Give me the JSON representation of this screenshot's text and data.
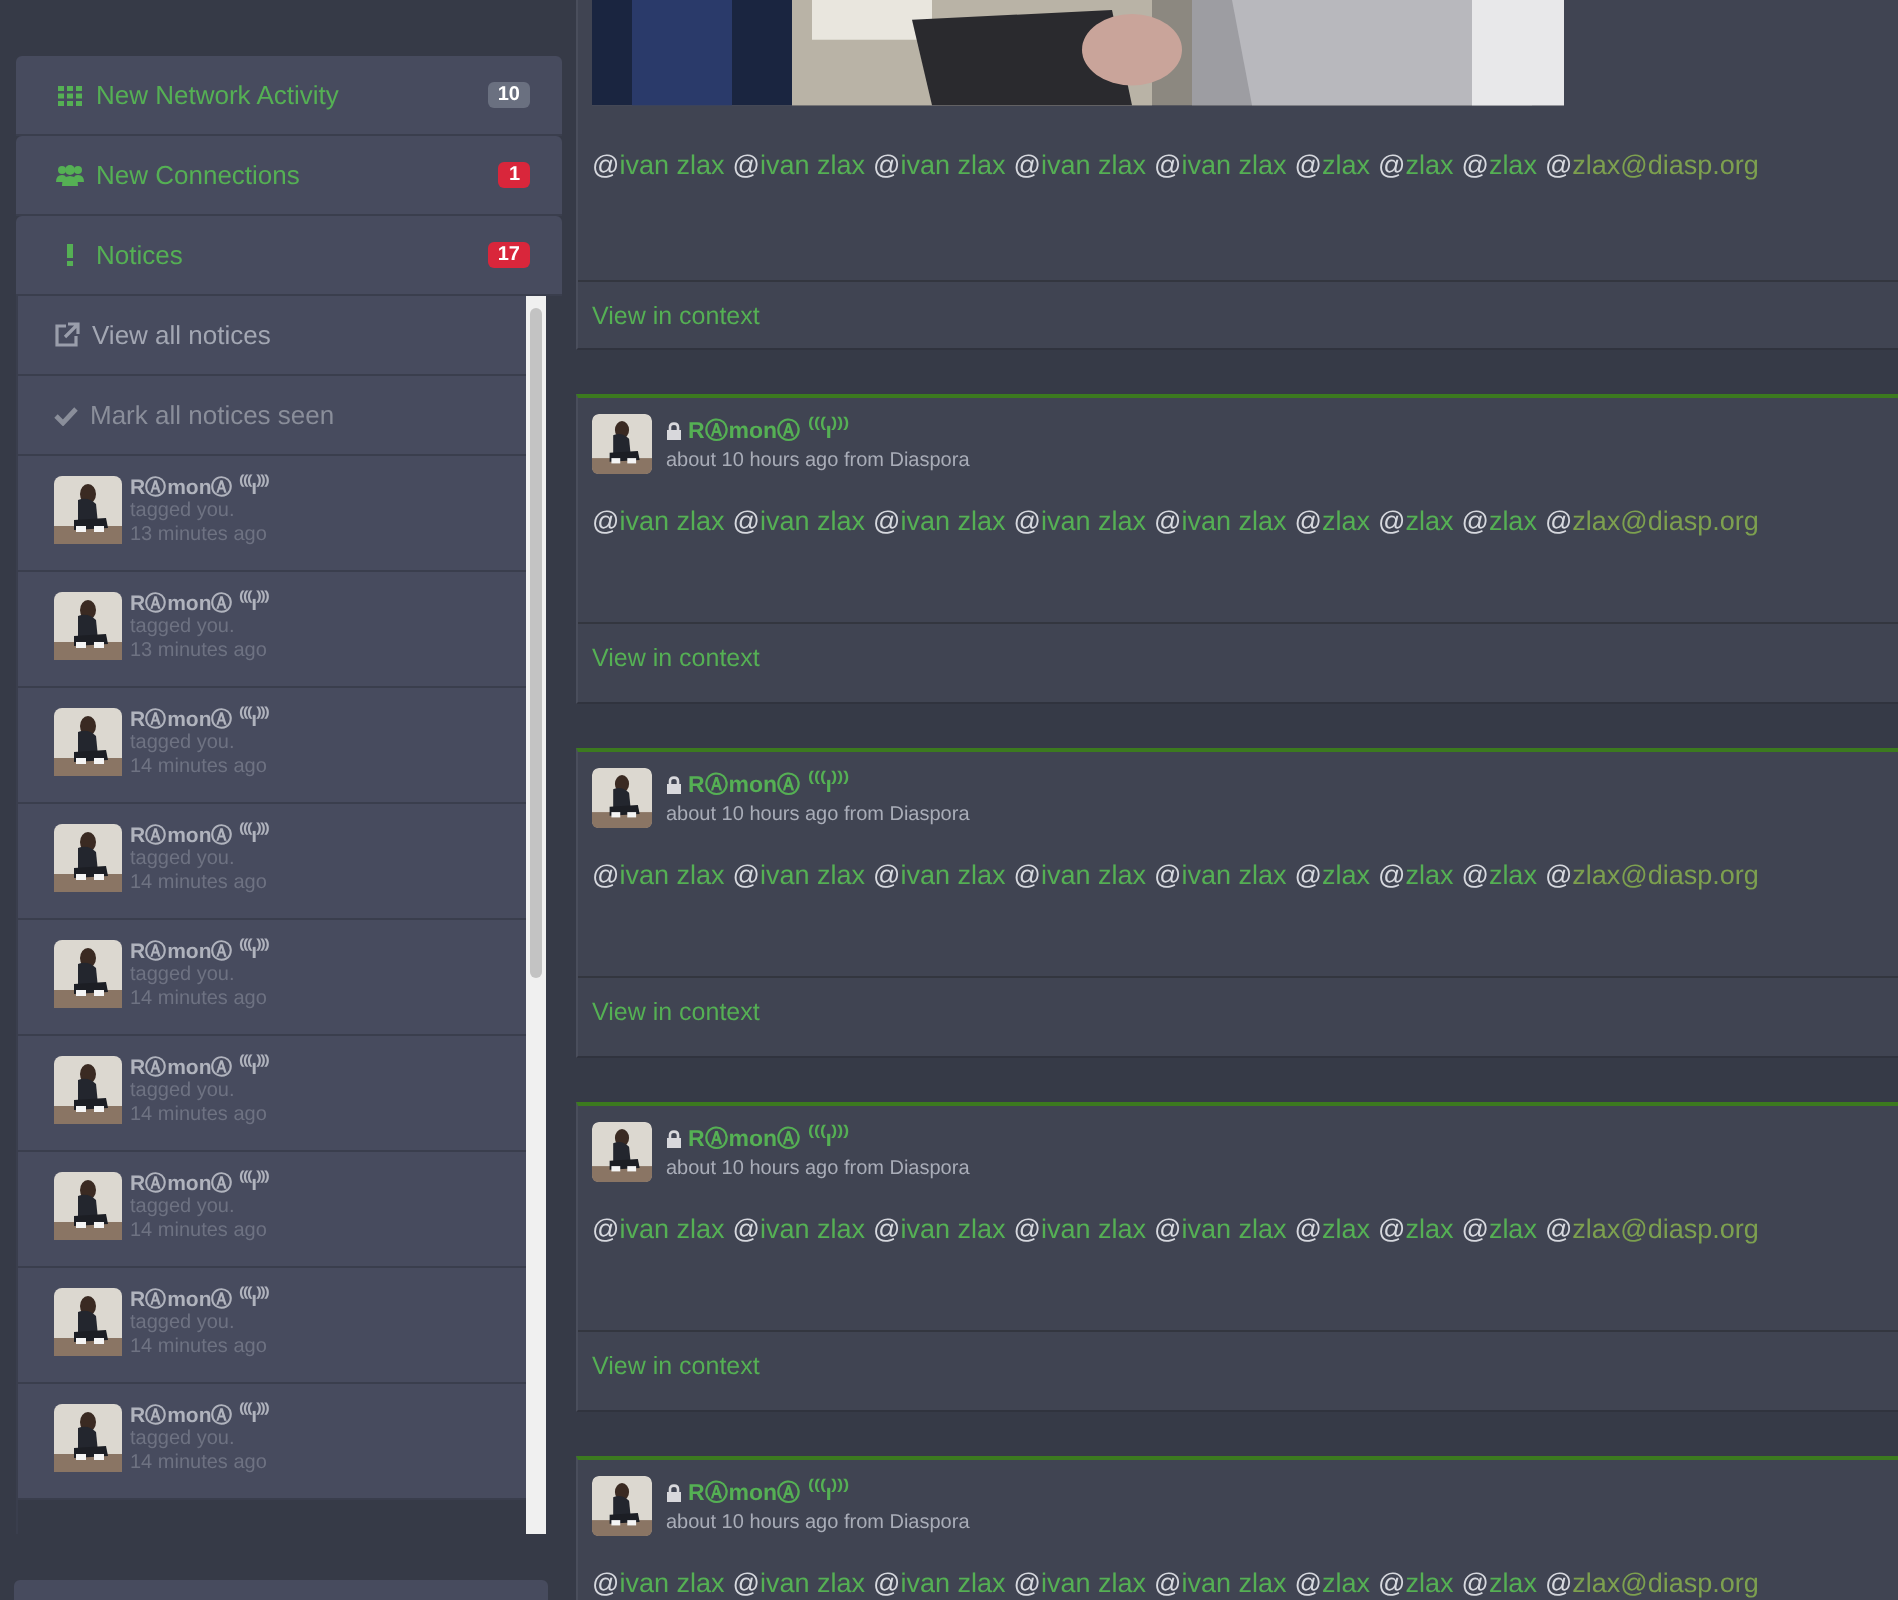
{
  "sidebar": {
    "menu": [
      {
        "label": "New Network Activity",
        "kind": "grid",
        "badge": "10",
        "color": "#6a7080"
      },
      {
        "label": "New Connections",
        "kind": "users",
        "badge": "1",
        "color": "#d9263b"
      },
      {
        "label": "Notices",
        "kind": "exclaim",
        "badge": "17",
        "color": "#d9263b"
      }
    ],
    "actions": [
      {
        "label": "View all notices",
        "kind": "external"
      },
      {
        "label": "Mark all notices seen",
        "kind": "check"
      }
    ],
    "notices": [
      {
        "name": "RⒶmonⒶ ⁽⁽⁽ı⁾⁾⁾",
        "text": "tagged you.",
        "time": "13 minutes ago"
      },
      {
        "name": "RⒶmonⒶ ⁽⁽⁽ı⁾⁾⁾",
        "text": "tagged you.",
        "time": "13 minutes ago"
      },
      {
        "name": "RⒶmonⒶ ⁽⁽⁽ı⁾⁾⁾",
        "text": "tagged you.",
        "time": "14 minutes ago"
      },
      {
        "name": "RⒶmonⒶ ⁽⁽⁽ı⁾⁾⁾",
        "text": "tagged you.",
        "time": "14 minutes ago"
      },
      {
        "name": "RⒶmonⒶ ⁽⁽⁽ı⁾⁾⁾",
        "text": "tagged you.",
        "time": "14 minutes ago"
      },
      {
        "name": "RⒶmonⒶ ⁽⁽⁽ı⁾⁾⁾",
        "text": "tagged you.",
        "time": "14 minutes ago"
      },
      {
        "name": "RⒶmonⒶ ⁽⁽⁽ı⁾⁾⁾",
        "text": "tagged you.",
        "time": "14 minutes ago"
      },
      {
        "name": "RⒶmonⒶ ⁽⁽⁽ı⁾⁾⁾",
        "text": "tagged you.",
        "time": "14 minutes ago"
      },
      {
        "name": "RⒶmonⒶ ⁽⁽⁽ı⁾⁾⁾",
        "text": "tagged you.",
        "time": "14 minutes ago"
      }
    ]
  },
  "posts": [
    {
      "kind": "picture",
      "mentions": [
        "@ivan zlax",
        "@ivan zlax",
        "@ivan zlax",
        "@ivan zlax",
        "@ivan zlax",
        "@zlax",
        "@zlax",
        "@zlax",
        "@zlax@diasp.org"
      ],
      "link": "View in context"
    },
    {
      "kind": "post",
      "author": "RⒶmonⒶ ⁽⁽⁽ı⁾⁾⁾",
      "locked": true,
      "meta": "about 10 hours ago from Diaspora",
      "mentions": [
        "@ivan zlax",
        "@ivan zlax",
        "@ivan zlax",
        "@ivan zlax",
        "@ivan zlax",
        "@zlax",
        "@zlax",
        "@zlax",
        "@zlax@diasp.org"
      ],
      "link": "View in context"
    },
    {
      "kind": "post",
      "author": "RⒶmonⒶ ⁽⁽⁽ı⁾⁾⁾",
      "locked": true,
      "meta": "about 10 hours ago from Diaspora",
      "mentions": [
        "@ivan zlax",
        "@ivan zlax",
        "@ivan zlax",
        "@ivan zlax",
        "@ivan zlax",
        "@zlax",
        "@zlax",
        "@zlax",
        "@zlax@diasp.org"
      ],
      "link": "View in context"
    },
    {
      "kind": "post",
      "author": "RⒶmonⒶ ⁽⁽⁽ı⁾⁾⁾",
      "locked": true,
      "meta": "about 10 hours ago from Diaspora",
      "mentions": [
        "@ivan zlax",
        "@ivan zlax",
        "@ivan zlax",
        "@ivan zlax",
        "@ivan zlax",
        "@zlax",
        "@zlax",
        "@zlax",
        "@zlax@diasp.org"
      ],
      "link": "View in context"
    },
    {
      "kind": "post",
      "author": "RⒶmonⒶ ⁽⁽⁽ı⁾⁾⁾",
      "locked": true,
      "meta": "about 10 hours ago from Diaspora",
      "mentions": [
        "@ivan zlax",
        "@ivan zlax",
        "@ivan zlax",
        "@ivan zlax",
        "@ivan zlax",
        "@zlax",
        "@zlax",
        "@zlax",
        "@zlax@diasp.org"
      ]
    }
  ]
}
